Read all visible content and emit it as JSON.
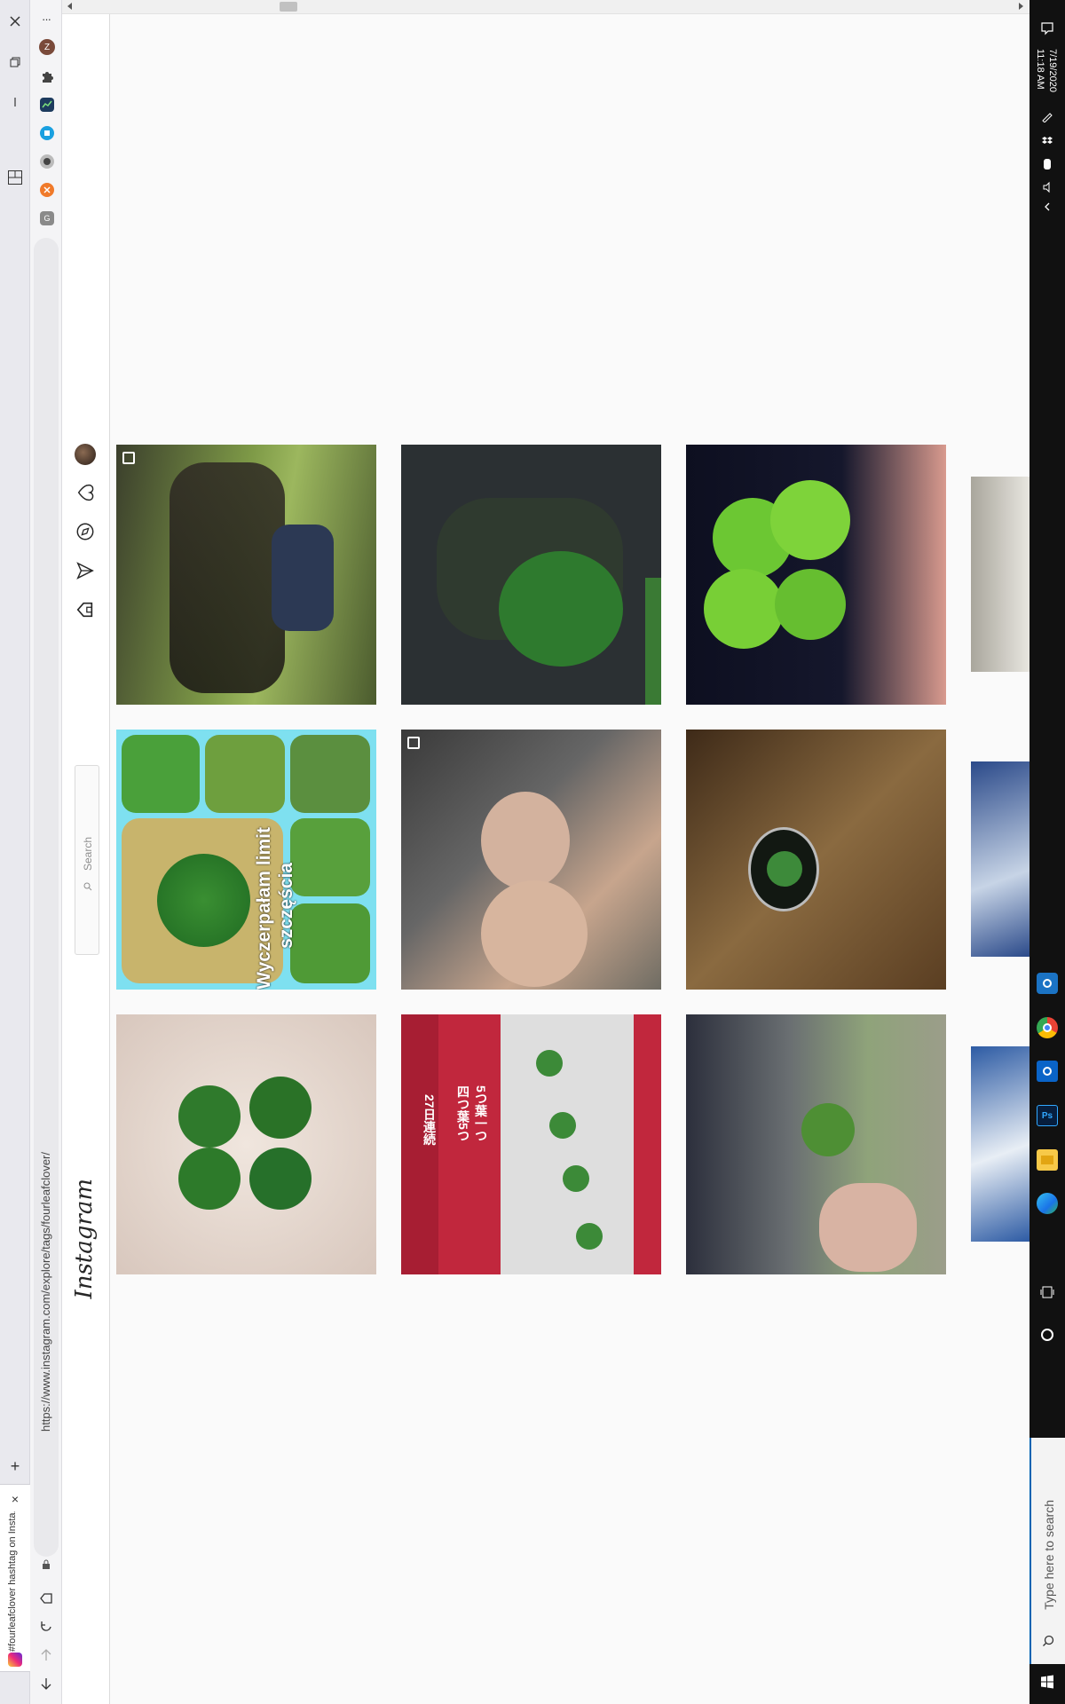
{
  "browser": {
    "tab_title": "#fourleafclover hashtag on Insta...",
    "url": "https://www.instagram.com/explore/tags/fourleafclover/",
    "new_tab_symbol": "+",
    "close_tab_symbol": "×",
    "menu_symbol": "···",
    "profile_initial": "Z"
  },
  "instagram": {
    "logo": "Instagram",
    "search_placeholder": "Search"
  },
  "grid": {
    "tiles": [
      {
        "id": "t1",
        "colors": [
          "#3a3a2a",
          "#6b8a3a",
          "#9bb35a",
          "#2a2f24"
        ]
      },
      {
        "id": "t2",
        "colors": [
          "#2b3033",
          "#2f3a2f",
          "#3a7a34",
          "#2b3033"
        ]
      },
      {
        "id": "t3",
        "colors": [
          "#0d0f20",
          "#1b1d33",
          "#7ecf3a",
          "#e8a99c"
        ]
      },
      {
        "id": "t4",
        "text1": "Wyczerpałam limit",
        "text2": "szczęścia",
        "colors": [
          "#7ee0f0",
          "#3e8f33",
          "#b9d38c",
          "#4aa03a"
        ]
      },
      {
        "id": "t5",
        "colors": [
          "#d8d4cc",
          "#333",
          "#9b9a98",
          "#bfa48c"
        ]
      },
      {
        "id": "t6",
        "colors": [
          "#3e2a18",
          "#7a5a36",
          "#a88458",
          "#1c3a1c"
        ]
      },
      {
        "id": "t7",
        "colors": [
          "#efe3db",
          "#c9b7ac",
          "#2f7a2c",
          "#e5cfc4"
        ]
      },
      {
        "id": "t8",
        "jp1": "27日連続",
        "jp2": "四つ葉5つ",
        "jp3": "5つ葉一つ",
        "colors": [
          "#c1273d",
          "#d9d9d9",
          "#3c8a38",
          "#a71e33"
        ]
      },
      {
        "id": "t9",
        "colors": [
          "#2c2f3c",
          "#6a6f72",
          "#8fa37a",
          "#d8b3a3"
        ]
      },
      {
        "id": "t10",
        "colors": [
          "#eaeae6",
          "#bbbbb6"
        ]
      },
      {
        "id": "t11",
        "colors": [
          "#2b4a8a",
          "#e8eef5"
        ]
      },
      {
        "id": "t12",
        "colors": [
          "#2d5ba4",
          "#e8eef5"
        ]
      }
    ]
  },
  "taskbar": {
    "time": "11:18 AM",
    "date": "7/19/2020",
    "search_placeholder": "Type here to search"
  },
  "colors": {
    "instagram_bg": "#fafafa",
    "taskbar": "#111111",
    "accent": "#0063b1"
  }
}
